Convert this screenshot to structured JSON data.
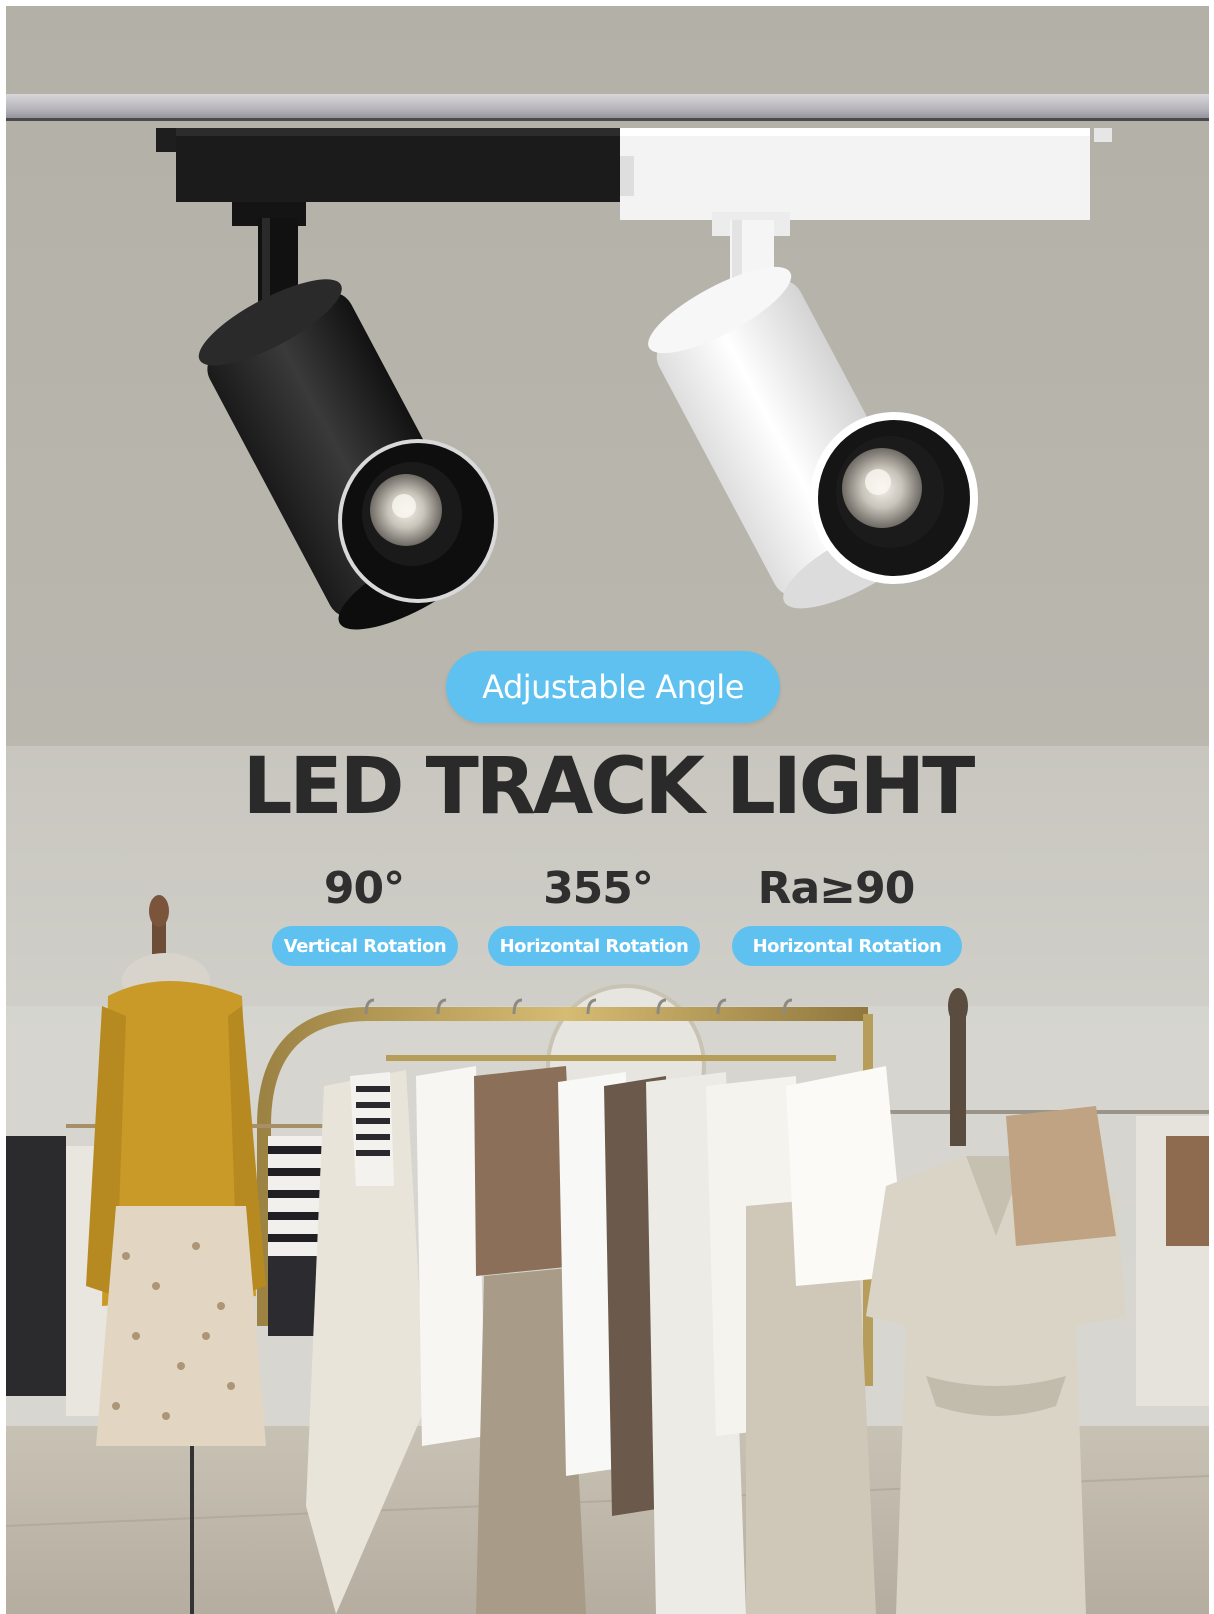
{
  "badge": {
    "label": "Adjustable Angle"
  },
  "headline": "LED TRACK LIGHT",
  "specs": [
    {
      "value": "90°",
      "label": "Vertical Rotation"
    },
    {
      "value": "355°",
      "label": "Horizontal Rotation"
    },
    {
      "value": "Ra≥90",
      "label": "Horizontal Rotation"
    }
  ],
  "colors": {
    "accent": "#5ec1ef",
    "headline_text": "#2a2a2a",
    "wall": "#b5b2a9"
  },
  "scene": {
    "products": [
      "black track light",
      "white track light"
    ],
    "icons": [
      "track-rail-icon",
      "black-spotlight-icon",
      "white-spotlight-icon"
    ]
  }
}
